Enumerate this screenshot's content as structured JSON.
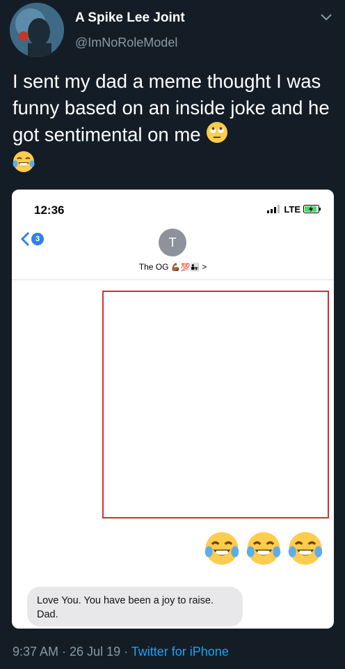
{
  "tweet": {
    "display_name": "A Spike Lee Joint",
    "handle": "@ImNoRoleModel",
    "text": "I sent my dad a meme thought I was funny based on an inside joke and he got sentimental on me",
    "emoji_1": "face-with-rolling-eyes",
    "emoji_2": "face-with-tears-of-joy"
  },
  "screenshot": {
    "status_time": "12:36",
    "network": "LTE",
    "back_badge_count": "3",
    "contact_initial": "T",
    "contact_name": "The OG",
    "contact_emojis": "💪🏾💯👨‍👧",
    "contact_chevron": ">",
    "laugh_emoji": "face-with-tears-of-joy",
    "laugh_emoji_count": 3,
    "incoming_message_line1": "Love You. You have been a joy to raise.",
    "incoming_message_line2": "Dad."
  },
  "footer": {
    "timestamp": "9:37 AM · 26 Jul 19 · ",
    "client": "Twitter for iPhone"
  },
  "colors": {
    "background": "#141d26",
    "muted_text": "#8899a6",
    "link": "#1da1f2",
    "highlight_box": "#e0282e",
    "imessage_blue": "#2f80ed",
    "bubble_gray": "#e8e8ea"
  }
}
